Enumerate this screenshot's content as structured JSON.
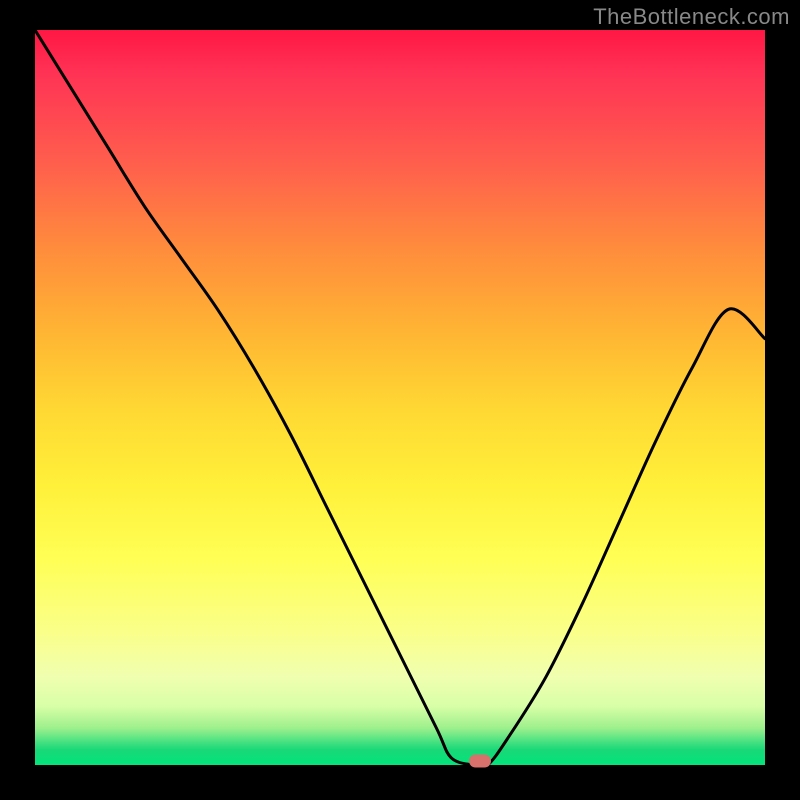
{
  "watermark": "TheBottleneck.com",
  "colors": {
    "background": "#000000",
    "gradient_top": "#ff1744",
    "gradient_mid": "#ffe040",
    "gradient_bottom": "#02e57c",
    "curve": "#000000",
    "marker": "#d8706c"
  },
  "chart_data": {
    "type": "line",
    "title": "",
    "xlabel": "",
    "ylabel": "",
    "xlim": [
      0,
      100
    ],
    "ylim": [
      0,
      100
    ],
    "x": [
      0,
      5,
      10,
      15,
      20,
      25,
      30,
      35,
      40,
      45,
      50,
      55,
      57,
      60,
      62,
      65,
      70,
      75,
      80,
      85,
      90,
      95,
      100
    ],
    "values": [
      100,
      92,
      84,
      76,
      69,
      62,
      54,
      45,
      35,
      25,
      15,
      5,
      1,
      0,
      0,
      4,
      12,
      22,
      33,
      44,
      54,
      62,
      58
    ],
    "series": [
      {
        "name": "bottleneck-curve",
        "x": [
          0,
          5,
          10,
          15,
          20,
          25,
          30,
          35,
          40,
          45,
          50,
          55,
          57,
          60,
          62,
          65,
          70,
          75,
          80,
          85,
          90,
          95,
          100
        ],
        "values": [
          100,
          92,
          84,
          76,
          69,
          62,
          54,
          45,
          35,
          25,
          15,
          5,
          1,
          0,
          0,
          4,
          12,
          22,
          33,
          44,
          54,
          62,
          58
        ]
      }
    ],
    "marker": {
      "x": 61,
      "y": 0.5
    },
    "annotations": []
  }
}
